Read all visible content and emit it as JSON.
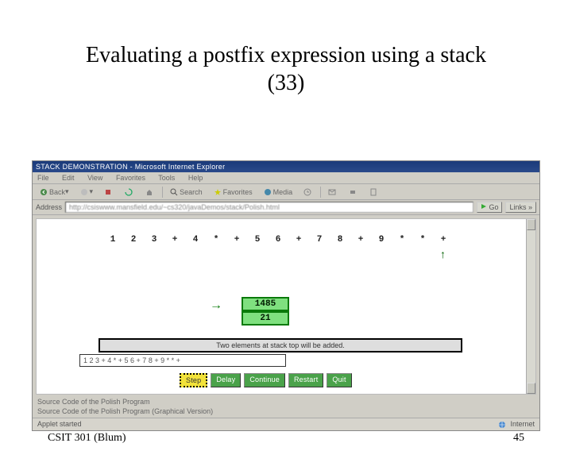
{
  "slide": {
    "title_line1": "Evaluating a postfix expression using a stack",
    "title_line2": "(33)",
    "footer_left": "CSIT 301 (Blum)",
    "footer_right": "45"
  },
  "browser": {
    "window_title": "STACK DEMONSTRATION - Microsoft Internet Explorer",
    "menus": {
      "a": "File",
      "b": "Edit",
      "c": "View",
      "d": "Favorites",
      "e": "Tools",
      "f": "Help"
    },
    "toolbar": {
      "back": "Back",
      "search": "Search",
      "favorites": "Favorites",
      "media": "Media"
    },
    "address_label": "Address",
    "url": "http://csiswww.mansfield.edu/~cs320/javaDemos/stack/Polish.html",
    "go": "Go",
    "links": "Links »"
  },
  "applet": {
    "tokens": [
      "1",
      "2",
      "3",
      "+",
      "4",
      "*",
      "+",
      "5",
      "6",
      "+",
      "7",
      "8",
      "+",
      "9",
      "*",
      "*",
      "+"
    ],
    "pointer_index": 16,
    "stack": {
      "top": "1485",
      "below": "21"
    },
    "status": "Two elements at stack top will be added.",
    "input_value": "1 2 3 + 4 * + 5 6 + 7 8 + 9 * * +",
    "buttons": {
      "step": "Step",
      "delay": "Delay",
      "continue": "Continue",
      "restart": "Restart",
      "quit": "Quit"
    }
  },
  "page_text": {
    "src1": "Source Code of the Polish Program",
    "src2": "Source Code of the Polish Program (Graphical Version)"
  },
  "statusbar": {
    "left": "Applet started",
    "right": "Internet"
  }
}
